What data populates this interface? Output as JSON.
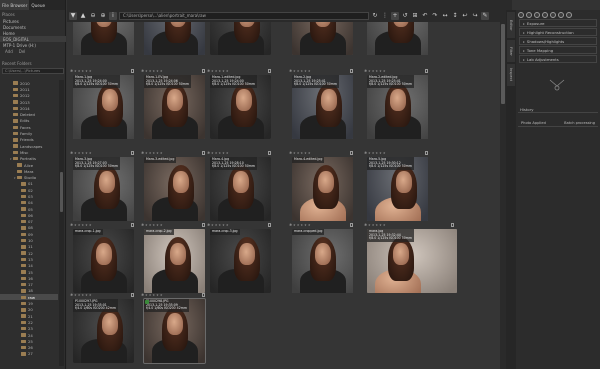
{
  "left": {
    "tabs": [
      "File Browser",
      "Queue"
    ],
    "places_header": "Places",
    "places": [
      "Pictures",
      "Documents",
      "Home",
      "EOS_DIGITAL",
      "MTP-1 Drive (H:)"
    ],
    "place_buttons": [
      "Add",
      "Del"
    ],
    "recent_header": "Recent Folders",
    "filter_placeholder": "C:\\Users\\...\\Pictures",
    "tree": [
      {
        "label": "2010",
        "depth": 2
      },
      {
        "label": "2011",
        "depth": 2
      },
      {
        "label": "2012",
        "depth": 2
      },
      {
        "label": "2013",
        "depth": 2
      },
      {
        "label": "2014",
        "depth": 2
      },
      {
        "label": "Deleted",
        "depth": 2
      },
      {
        "label": "Edits",
        "depth": 2
      },
      {
        "label": "Faces",
        "depth": 2
      },
      {
        "label": "Family",
        "depth": 2
      },
      {
        "label": "Friends",
        "depth": 2
      },
      {
        "label": "Landscapes",
        "depth": 2
      },
      {
        "label": "Misc",
        "depth": 2
      },
      {
        "label": "Portraits",
        "depth": 2,
        "open": true
      },
      {
        "label": "Alice",
        "depth": 3
      },
      {
        "label": "Mara",
        "depth": 3
      },
      {
        "label": "Studio",
        "depth": 3,
        "open": true
      },
      {
        "label": "01",
        "depth": 4
      },
      {
        "label": "02",
        "depth": 4
      },
      {
        "label": "03",
        "depth": 4
      },
      {
        "label": "04",
        "depth": 4
      },
      {
        "label": "05",
        "depth": 4
      },
      {
        "label": "06",
        "depth": 4
      },
      {
        "label": "07",
        "depth": 4
      },
      {
        "label": "08",
        "depth": 4
      },
      {
        "label": "09",
        "depth": 4
      },
      {
        "label": "10",
        "depth": 4
      },
      {
        "label": "11",
        "depth": 4
      },
      {
        "label": "12",
        "depth": 4
      },
      {
        "label": "13",
        "depth": 4
      },
      {
        "label": "14",
        "depth": 4
      },
      {
        "label": "15",
        "depth": 4
      },
      {
        "label": "16",
        "depth": 4
      },
      {
        "label": "17",
        "depth": 4
      },
      {
        "label": "18",
        "depth": 4
      },
      {
        "label": "raw",
        "depth": 4,
        "selected": true
      },
      {
        "label": "19",
        "depth": 4
      },
      {
        "label": "20",
        "depth": 4
      },
      {
        "label": "21",
        "depth": 4
      },
      {
        "label": "22",
        "depth": 4
      },
      {
        "label": "23",
        "depth": 4
      },
      {
        "label": "24",
        "depth": 4
      },
      {
        "label": "25",
        "depth": 4
      },
      {
        "label": "26",
        "depth": 4
      },
      {
        "label": "27",
        "depth": 4
      }
    ]
  },
  "toolbar": {
    "path": "C:\\Users\\perso\\...\\alien\\portrait_mara\\raw"
  },
  "grid": {
    "rows": [
      [
        {
          "name": "",
          "line1": "",
          "line2": "",
          "look": "grey"
        },
        {
          "name": "",
          "line1": "",
          "line2": "",
          "look": "slate"
        },
        {
          "name": "",
          "line1": "",
          "line2": "",
          "look": "dark"
        },
        {
          "name": "",
          "line1": "",
          "line2": "",
          "look": "warm"
        },
        {
          "name": "",
          "line1": "",
          "line2": "",
          "look": "grey"
        }
      ],
      [
        {
          "name": "Mara-1.jpg",
          "line1": "2013-1-25 19:24:00",
          "line2": "f/8.0 1/125s ISO100 50mm",
          "look": "grey"
        },
        {
          "name": "Mara-1-EV.jpg",
          "line1": "2013-1-25 19:24:06",
          "line2": "f/8.0 1/125s ISO100 50mm",
          "look": "warm"
        },
        {
          "name": "Mara-1-edited.jpg",
          "line1": "2013-1-25 19:24:00",
          "line2": "f/8.0 1/125s ISO100 50mm",
          "look": "dark"
        },
        {
          "name": "Mara-2.jpg",
          "line1": "2013-1-25 19:25:41",
          "line2": "f/8.0 1/125s ISO100 50mm",
          "look": "slate"
        },
        {
          "name": "Mara-2-edited.jpg",
          "line1": "2013-1-25 19:25:41",
          "line2": "f/8.0 1/125s ISO100 50mm",
          "look": "grey"
        }
      ],
      [
        {
          "name": "Mara-3.jpg",
          "line1": "2013-1-25 19:27:03",
          "line2": "f/8.0 1/125s ISO100 50mm",
          "look": "grey"
        },
        {
          "name": "Mara-3-edited.jpg",
          "line1": "",
          "line2": "",
          "look": "warm"
        },
        {
          "name": "Mara-4.jpg",
          "line1": "2013-1-25 19:28:10",
          "line2": "f/8.0 1/125s ISO100 50mm",
          "look": "dark"
        },
        {
          "name": "Mara-4-edited.jpg",
          "line1": "",
          "line2": "",
          "look": "warm",
          "nude": true
        },
        {
          "name": "Mara-5.jpg",
          "line1": "2013-1-25 19:30:12",
          "line2": "f/8.0 1/125s ISO100 50mm",
          "look": "slate",
          "nude": true
        }
      ],
      [
        {
          "name": "mara-crop-1.jpg",
          "line1": "",
          "line2": "",
          "look": "dark"
        },
        {
          "name": "mara-crop-2.jpg",
          "line1": "",
          "line2": "",
          "look": "light"
        },
        {
          "name": "mara-crop-3.jpg",
          "line1": "",
          "line2": "",
          "look": "dark"
        },
        {
          "name": "mara-cropped.jpg",
          "line1": "",
          "line2": "",
          "look": "grey"
        },
        {
          "name": "mara.jpg",
          "line1": "2013-1-25 19:32:44",
          "line2": "f/8.0 1/125s ISO100 50mm",
          "look": "light",
          "nude": true,
          "wide": true
        }
      ],
      [
        {
          "name": "P1000297.JPG",
          "line1": "2013-1-25 19:35:01",
          "line2": "f/4.0 1/60s ISO200 42mm",
          "look": "dark"
        },
        {
          "name": "P1000298.JPG",
          "line1": "2013-1-25 19:35:09",
          "line2": "f/4.0 1/60s ISO200 42mm",
          "look": "warm",
          "selected": true
        }
      ]
    ]
  },
  "right": {
    "vtabs": [
      "Editor",
      "Filter",
      "Inspect"
    ],
    "tools": [
      "Exposure",
      "Highlight Reconstruction",
      "Shadows/Highlights",
      "Tone Mapping",
      "Lab Adjustments"
    ],
    "history_label": "History",
    "col_left": "Photo Applied",
    "col_right": "Batch processing"
  }
}
